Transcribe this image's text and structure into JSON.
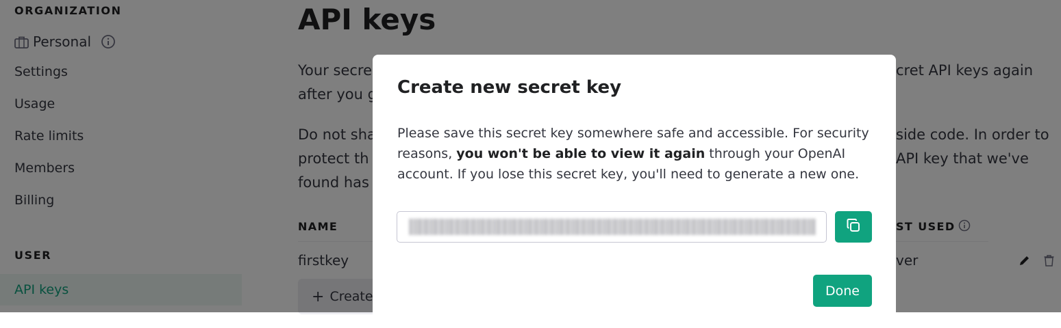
{
  "sidebar": {
    "organization_heading": "ORGANIZATION",
    "org_name": "Personal",
    "items": [
      {
        "label": "Settings"
      },
      {
        "label": "Usage"
      },
      {
        "label": "Rate limits"
      },
      {
        "label": "Members"
      },
      {
        "label": "Billing"
      }
    ],
    "user_heading": "USER",
    "active_item": "API keys"
  },
  "main": {
    "title": "API keys",
    "intro_left": [
      "Your secre",
      "after you g"
    ],
    "intro_right": [
      "cret API keys again",
      ""
    ],
    "warning_left": [
      "Do not sha",
      "protect th",
      "found has"
    ],
    "warning_right": [
      "side code. In order to",
      "API key that we've",
      ""
    ],
    "table": {
      "col_name": "NAME",
      "col_last_used": "ST USED",
      "row": {
        "name": "firstkey",
        "last_used": "ver"
      }
    },
    "create_button": "Create"
  },
  "modal": {
    "title": "Create new secret key",
    "text_before_bold": "Please save this secret key somewhere safe and accessible. For security reasons, ",
    "text_bold": "you won't be able to view it again",
    "text_after_bold": " through your OpenAI account. If you lose this secret key, you'll need to generate a new one.",
    "done_label": "Done"
  },
  "colors": {
    "accent": "#10a37f",
    "overlay": "rgba(0,0,0,0.5)"
  },
  "icons": {
    "org": "briefcase-icon",
    "info": "info-icon",
    "copy": "copy-icon",
    "edit": "pencil-icon",
    "delete": "trash-icon",
    "plus": "plus-icon"
  }
}
